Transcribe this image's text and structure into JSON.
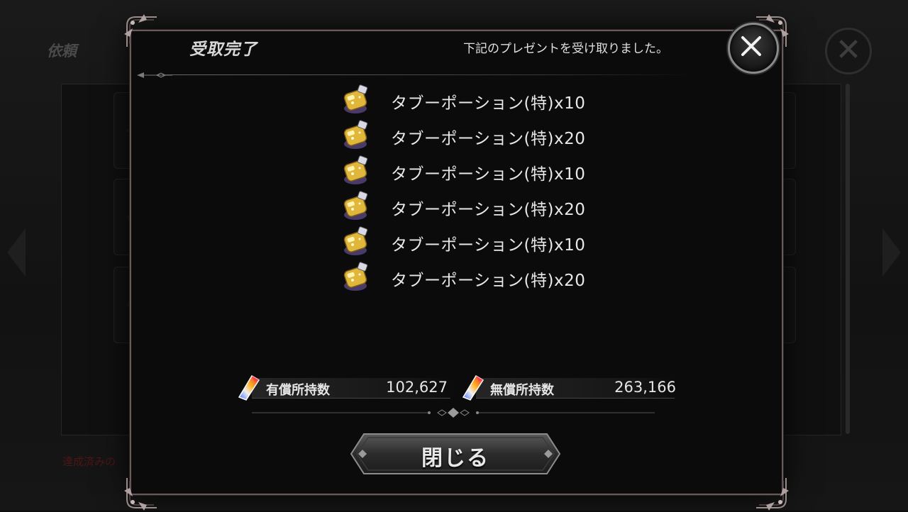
{
  "background": {
    "title": "依頼",
    "notice": "達成済みの"
  },
  "dialog": {
    "title": "受取完了",
    "message": "下記のプレゼントを受け取りました。",
    "items": [
      {
        "label": "タブーポーション(特)x10",
        "icon": "potion-icon"
      },
      {
        "label": "タブーポーション(特)x20",
        "icon": "potion-icon"
      },
      {
        "label": "タブーポーション(特)x10",
        "icon": "potion-icon"
      },
      {
        "label": "タブーポーション(特)x20",
        "icon": "potion-icon"
      },
      {
        "label": "タブーポーション(特)x10",
        "icon": "potion-icon"
      },
      {
        "label": "タブーポーション(特)x20",
        "icon": "potion-icon"
      }
    ],
    "currency": {
      "paid": {
        "label": "有償所持数",
        "value": "102,627",
        "icon": "crystal-icon"
      },
      "free": {
        "label": "無償所持数",
        "value": "263,166",
        "icon": "crystal-icon"
      }
    },
    "close_button_label": "閉じる",
    "close_icon": "close-icon"
  },
  "colors": {
    "background": "#0d0d0d",
    "dialog_bg": "#0b0b0b",
    "border": "#6a5a5a",
    "text": "#e6e6e6",
    "potion_gold": "#e0b73a",
    "notice_red": "#4d1616"
  }
}
